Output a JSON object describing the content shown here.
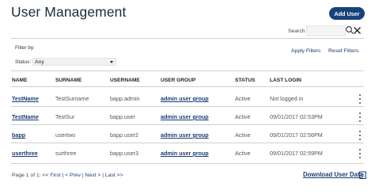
{
  "header": {
    "title": "User Management",
    "add_button": "Add User"
  },
  "search": {
    "label": "Search",
    "value": ""
  },
  "filters": {
    "filter_by_label": "Filter by:",
    "status_label": "Status:",
    "status_value": "Any",
    "apply_label": "Apply Filters",
    "reset_label": "Reset Filters"
  },
  "table": {
    "columns": [
      "NAME",
      "SURNAME",
      "USERNAME",
      "USER GROUP",
      "STATUS",
      "LAST LOGIN"
    ],
    "rows": [
      {
        "name": "TestName",
        "surname": "TestSurname",
        "username": "bapp.admin",
        "group": "admin user group",
        "status": "Active",
        "last_login": "Not logged in"
      },
      {
        "name": "TestName",
        "surname": "TestSur",
        "username": "bapp.user",
        "group": "admin user group",
        "status": "Active",
        "last_login": "09/01/2017 02:53PM"
      },
      {
        "name": "bapp",
        "surname": "usertwo",
        "username": "bapp.user2",
        "group": "admin user group",
        "status": "Active",
        "last_login": "09/01/2017 02:56PM"
      },
      {
        "name": "userthree",
        "surname": "surthree",
        "username": "bapp.user3",
        "group": "admin user group",
        "status": "Active",
        "last_login": "09/01/2017 02:59PM"
      }
    ]
  },
  "pagination": {
    "page_text": "Page 1 of 1:",
    "first": "<< First",
    "prev": "< Prev",
    "next": "Next >",
    "last": "Last >>"
  },
  "download_label": "Download User Data",
  "colors": {
    "accent": "#16437a",
    "link": "#1b3d73"
  },
  "icons": [
    "search-icon",
    "close-icon",
    "chevron-down-icon",
    "more-vertical-icon",
    "export-icon"
  ]
}
